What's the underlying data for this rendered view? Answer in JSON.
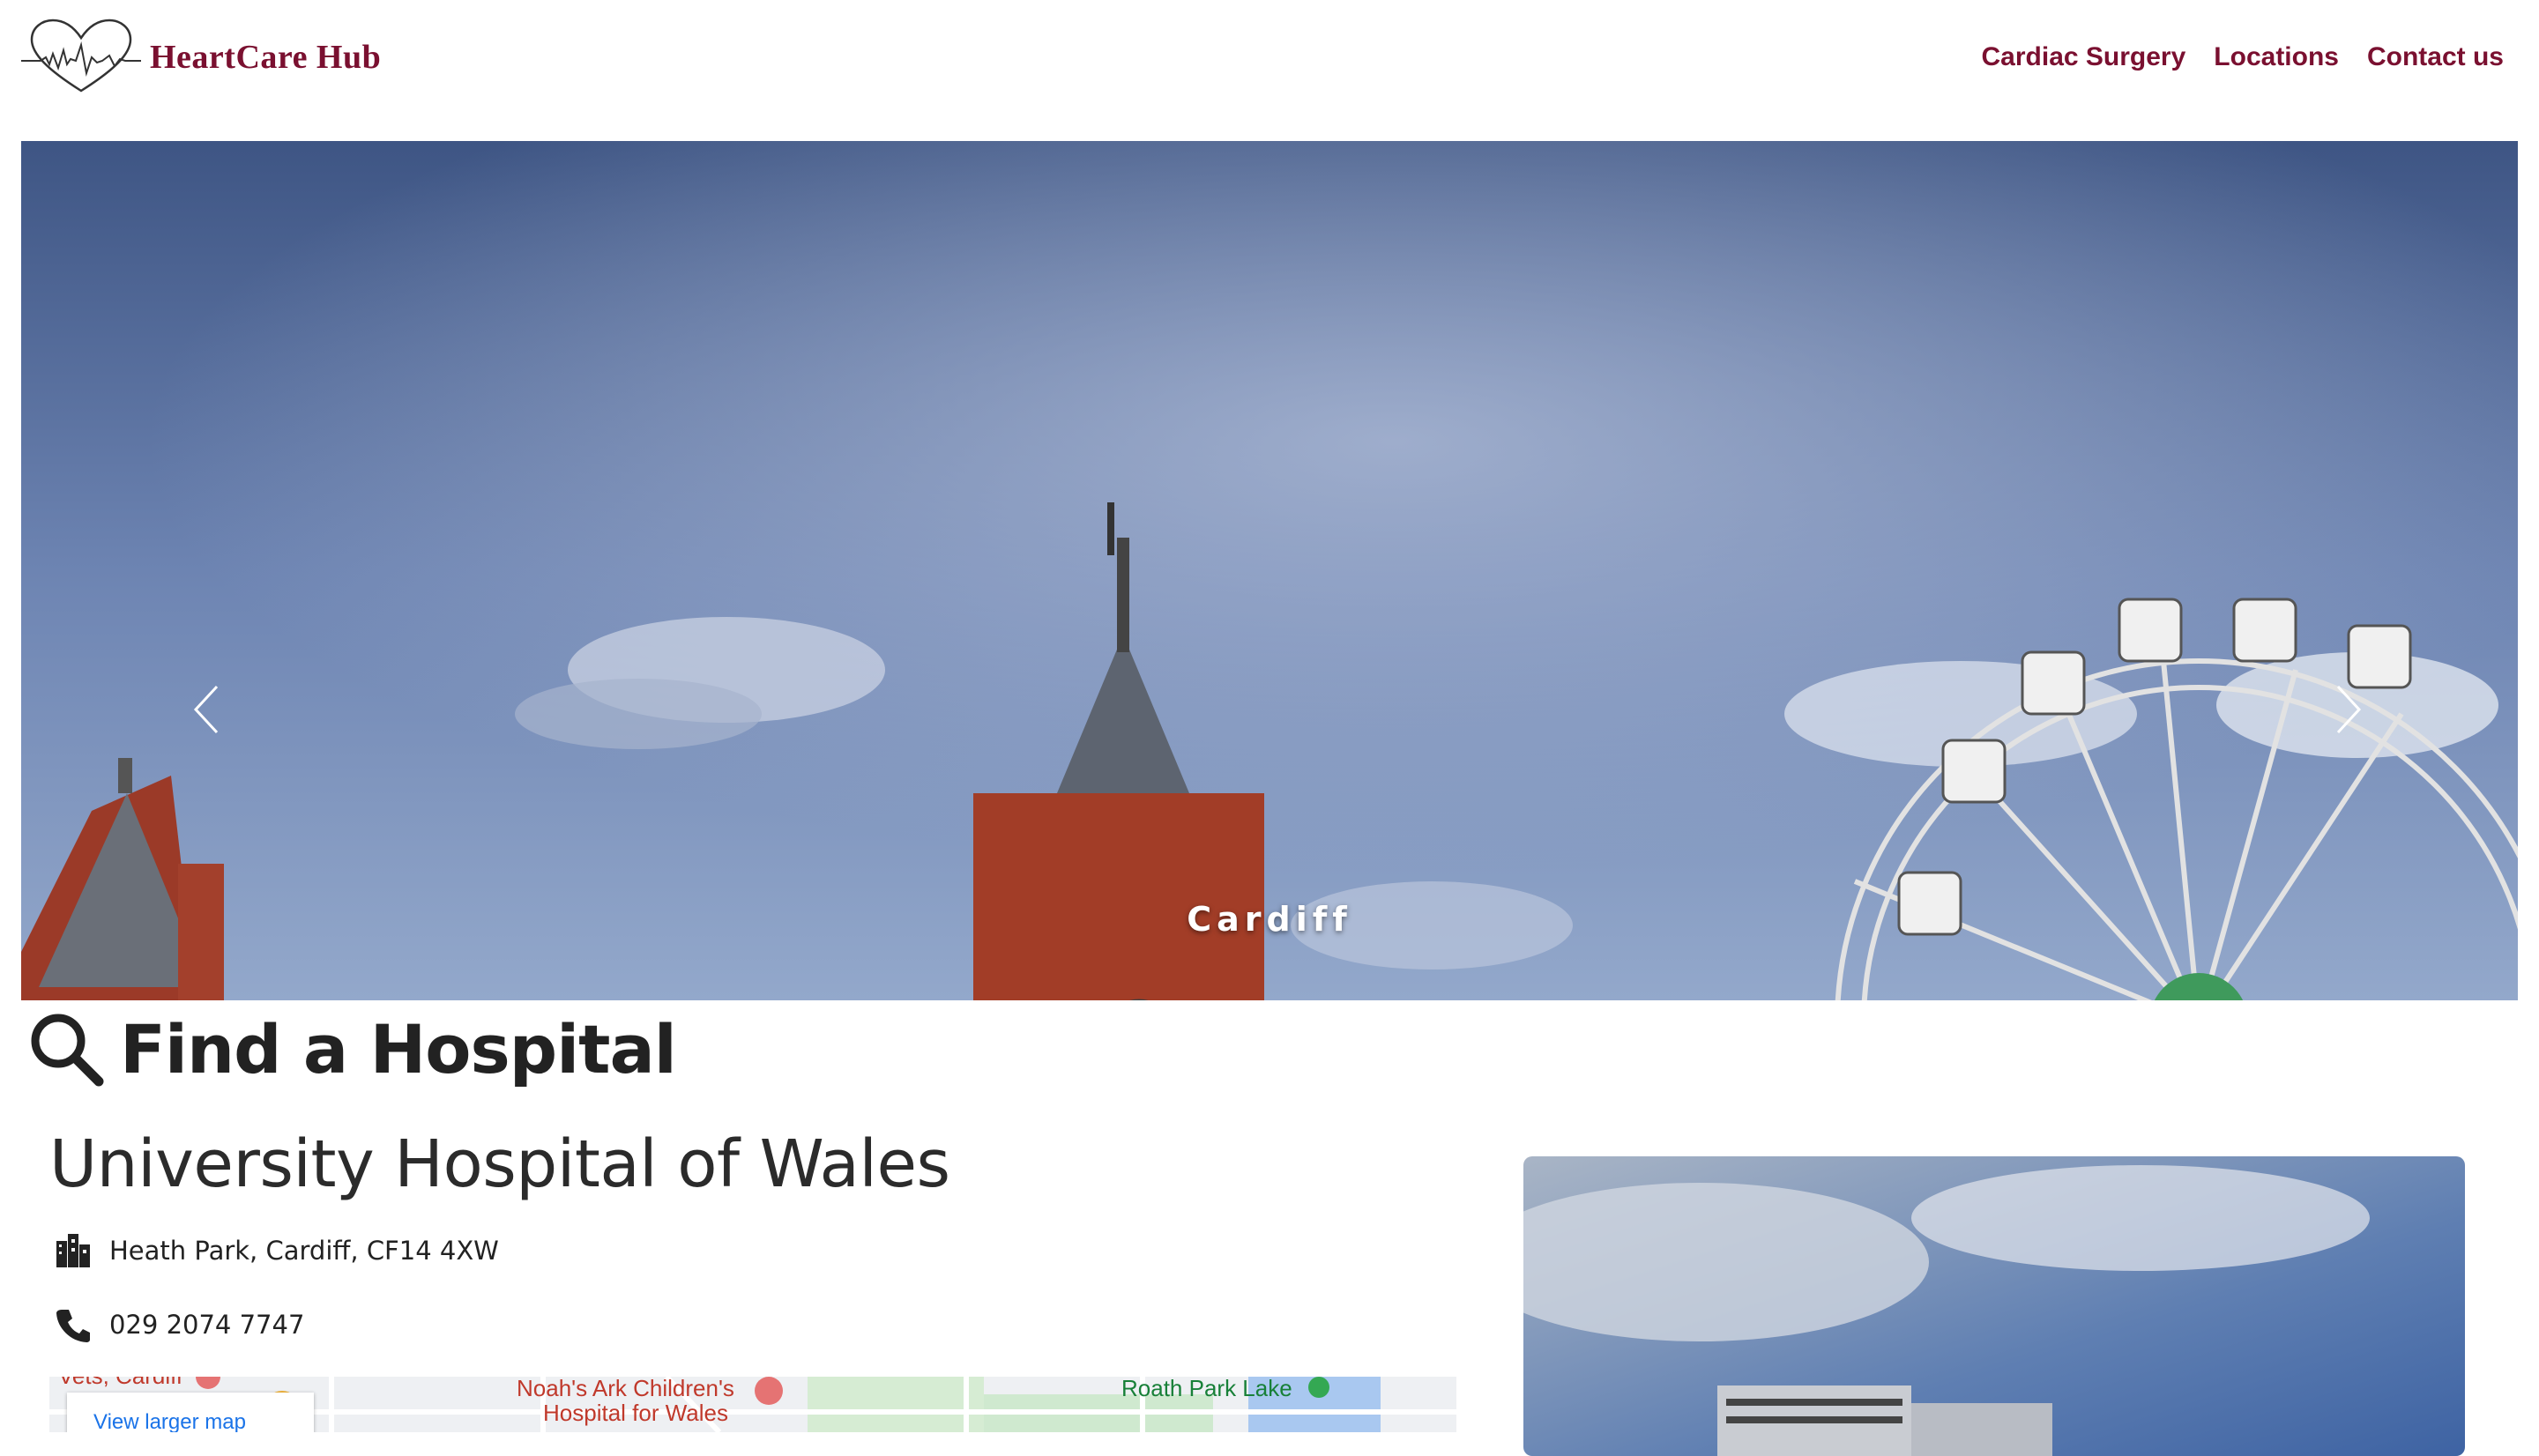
{
  "brand": {
    "name": "HeartCare Hub",
    "color": "#7a1030",
    "logo_icon": "heart-ecg-icon"
  },
  "nav": {
    "items": [
      {
        "label": "Cardiac Surgery"
      },
      {
        "label": "Locations"
      },
      {
        "label": "Contact us"
      }
    ]
  },
  "hero": {
    "caption": "Cardiff",
    "prev_icon": "chevron-left-icon",
    "next_icon": "chevron-right-icon"
  },
  "find": {
    "heading": "Find a Hospital",
    "icon": "search-icon"
  },
  "hospital": {
    "name": "University Hospital of Wales",
    "address": "Heath Park, Cardiff, CF14 4XW",
    "phone": "029 2074 7747",
    "address_icon": "hospital-building-icon",
    "phone_icon": "phone-icon"
  },
  "map": {
    "larger_link": "View larger map",
    "labels": {
      "vets": "Vets, Cardiff",
      "childrens_line1": "Noah's Ark Children's",
      "childrens_line2": "Hospital for Wales",
      "lake": "Roath Park Lake"
    }
  }
}
